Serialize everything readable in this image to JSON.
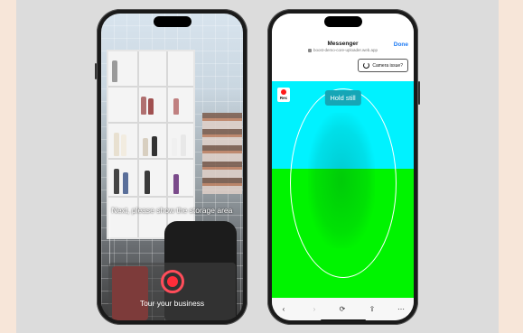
{
  "phone_left": {
    "caption": "Next, please show the storage area",
    "sheet_label": "Tour your business",
    "record_button_color": "#ff2d3a"
  },
  "phone_right": {
    "app_title": "Messenger",
    "url": "boost-demo-core-uploader.web.app",
    "done_label": "Done",
    "camera_issue_label": "Camera issue?",
    "rec_label": "Rec",
    "hold_still_label": "Hold still",
    "colors": {
      "top_band": "#00f2ff",
      "bottom_band": "#00f400",
      "hint_bg": "#16a6b6",
      "done_link": "#1d7af3"
    },
    "toolbar_icons": [
      "back-arrow-icon",
      "forward-arrow-icon",
      "refresh-icon",
      "share-icon",
      "more-icon"
    ]
  }
}
